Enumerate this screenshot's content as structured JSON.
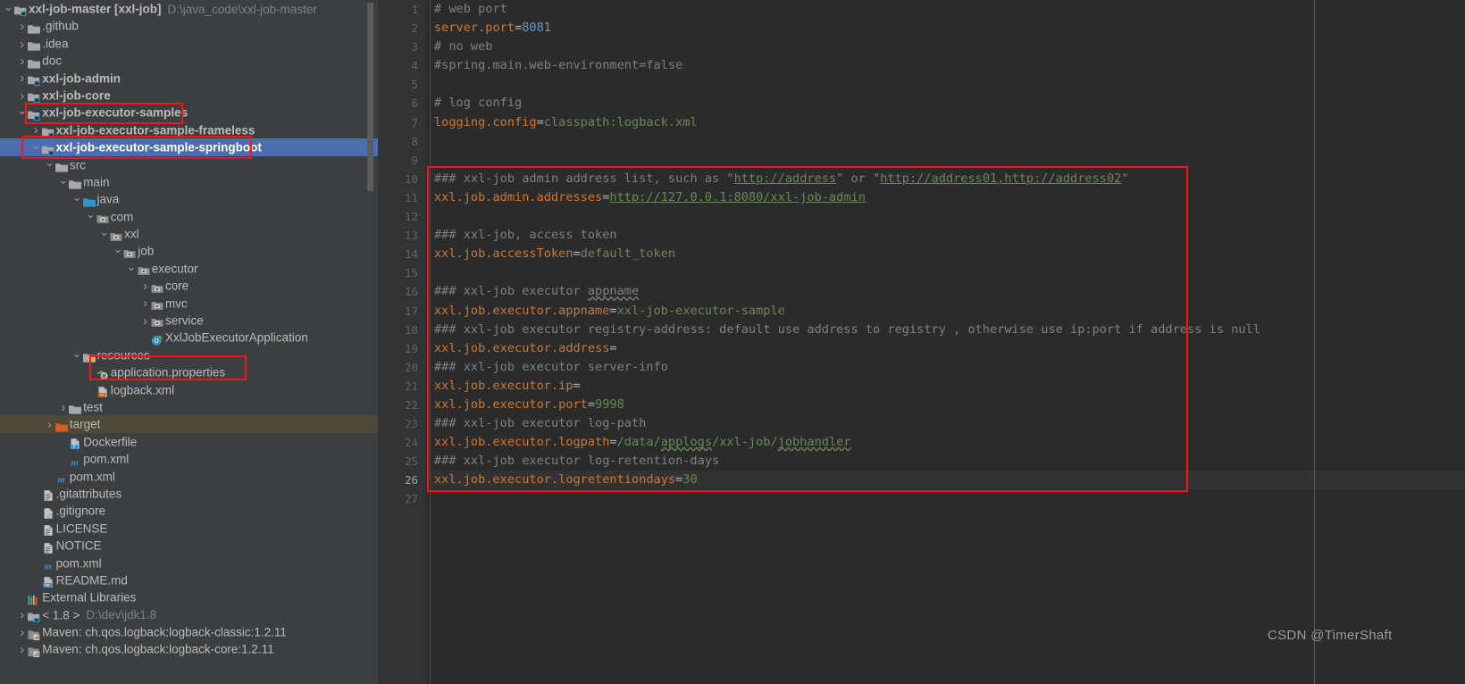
{
  "window": {
    "watermark": "CSDN @TimerShaft"
  },
  "tree": {
    "root": {
      "name": "xxl-job-master",
      "module": "[xxl-job]",
      "path": "D:\\java_code\\xxl-job-master"
    },
    "items": [
      {
        "indent": 0,
        "arrow": "v",
        "icon": "module-icon",
        "label": "xxl-job-master [xxl-job]",
        "suffix": "D:\\java_code\\xxl-job-master",
        "style": "root"
      },
      {
        "indent": 1,
        "arrow": ">",
        "icon": "folder-icon",
        "label": ".github"
      },
      {
        "indent": 1,
        "arrow": ">",
        "icon": "folder-icon",
        "label": ".idea"
      },
      {
        "indent": 1,
        "arrow": ">",
        "icon": "folder-icon",
        "label": "doc"
      },
      {
        "indent": 1,
        "arrow": ">",
        "icon": "module-icon",
        "label": "xxl-job-admin",
        "bold": true
      },
      {
        "indent": 1,
        "arrow": ">",
        "icon": "module-icon",
        "label": "xxl-job-core",
        "bold": true
      },
      {
        "indent": 1,
        "arrow": "v",
        "icon": "module-icon",
        "label": "xxl-job-executor-samples",
        "bold": true,
        "boxed": true
      },
      {
        "indent": 2,
        "arrow": ">",
        "icon": "module-icon",
        "label": "xxl-job-executor-sample-frameless",
        "bold": true
      },
      {
        "indent": 2,
        "arrow": "v",
        "icon": "module-icon",
        "label": "xxl-job-executor-sample-springboot",
        "bold": true,
        "selected": true,
        "boxed": true
      },
      {
        "indent": 3,
        "arrow": "v",
        "icon": "folder-icon",
        "label": "src"
      },
      {
        "indent": 4,
        "arrow": "v",
        "icon": "folder-icon",
        "label": "main"
      },
      {
        "indent": 5,
        "arrow": "v",
        "icon": "source-folder-icon",
        "label": "java"
      },
      {
        "indent": 6,
        "arrow": "v",
        "icon": "package-icon",
        "label": "com"
      },
      {
        "indent": 7,
        "arrow": "v",
        "icon": "package-icon",
        "label": "xxl"
      },
      {
        "indent": 8,
        "arrow": "v",
        "icon": "package-icon",
        "label": "job"
      },
      {
        "indent": 9,
        "arrow": "v",
        "icon": "package-icon",
        "label": "executor"
      },
      {
        "indent": 10,
        "arrow": ">",
        "icon": "package-icon",
        "label": "core"
      },
      {
        "indent": 10,
        "arrow": ">",
        "icon": "package-icon",
        "label": "mvc"
      },
      {
        "indent": 10,
        "arrow": ">",
        "icon": "package-icon",
        "label": "service"
      },
      {
        "indent": 10,
        "arrow": "none",
        "icon": "spring-class-icon",
        "label": "XxlJobExecutorApplication"
      },
      {
        "indent": 5,
        "arrow": "v",
        "icon": "resources-folder-icon",
        "label": "resources"
      },
      {
        "indent": 6,
        "arrow": "none",
        "icon": "properties-file-icon",
        "label": "application.properties",
        "boxed": true
      },
      {
        "indent": 6,
        "arrow": "none",
        "icon": "xml-file-icon",
        "label": "logback.xml"
      },
      {
        "indent": 4,
        "arrow": ">",
        "icon": "folder-icon",
        "label": "test"
      },
      {
        "indent": 3,
        "arrow": ">",
        "icon": "target-folder-icon",
        "label": "target",
        "hovered": true
      },
      {
        "indent": 4,
        "arrow": "none",
        "icon": "docker-file-icon",
        "label": "Dockerfile"
      },
      {
        "indent": 4,
        "arrow": "none",
        "icon": "maven-icon",
        "label": "pom.xml"
      },
      {
        "indent": 3,
        "arrow": "none",
        "icon": "maven-icon",
        "label": "pom.xml"
      },
      {
        "indent": 2,
        "arrow": "none",
        "icon": "text-file-icon",
        "label": ".gitattributes"
      },
      {
        "indent": 2,
        "arrow": "none",
        "icon": "gitignore-file-icon",
        "label": ".gitignore"
      },
      {
        "indent": 2,
        "arrow": "none",
        "icon": "text-file-icon",
        "label": "LICENSE"
      },
      {
        "indent": 2,
        "arrow": "none",
        "icon": "text-file-icon",
        "label": "NOTICE"
      },
      {
        "indent": 2,
        "arrow": "none",
        "icon": "maven-icon",
        "label": "pom.xml"
      },
      {
        "indent": 2,
        "arrow": "none",
        "icon": "markdown-file-icon",
        "label": "README.md"
      },
      {
        "indent": 1,
        "arrow": "none",
        "icon": "external-libraries-icon",
        "label": "External Libraries"
      },
      {
        "indent": 1,
        "arrow": ">",
        "icon": "jdk-icon",
        "label": "< 1.8 >",
        "suffix": "D:\\dev\\jdk1.8"
      },
      {
        "indent": 1,
        "arrow": ">",
        "icon": "library-icon",
        "label": "Maven: ch.qos.logback:logback-classic:1.2.11"
      },
      {
        "indent": 1,
        "arrow": ">",
        "icon": "library-icon",
        "label": "Maven: ch.qos.logback:logback-core:1.2.11"
      }
    ]
  },
  "editor": {
    "filename": "application.properties",
    "current_line": 26,
    "total_lines": 27,
    "line_numbers": [
      1,
      2,
      3,
      4,
      5,
      6,
      7,
      8,
      9,
      10,
      11,
      12,
      13,
      14,
      15,
      16,
      17,
      18,
      19,
      20,
      21,
      22,
      23,
      24,
      25,
      26,
      27
    ],
    "lines": [
      {
        "n": 1,
        "text": "# web port"
      },
      {
        "n": 2,
        "text": "server.port=8081"
      },
      {
        "n": 3,
        "text": "# no web"
      },
      {
        "n": 4,
        "text": "#spring.main.web-environment=false"
      },
      {
        "n": 5,
        "text": ""
      },
      {
        "n": 6,
        "text": "# log config"
      },
      {
        "n": 7,
        "text": "logging.config=classpath:logback.xml"
      },
      {
        "n": 8,
        "text": ""
      },
      {
        "n": 9,
        "text": ""
      },
      {
        "n": 10,
        "text": "### xxl-job admin address list, such as \"http://address\" or \"http://address01,http://address02\""
      },
      {
        "n": 11,
        "text": "xxl.job.admin.addresses=http://127.0.0.1:8080/xxl-job-admin"
      },
      {
        "n": 12,
        "text": ""
      },
      {
        "n": 13,
        "text": "### xxl-job, access token"
      },
      {
        "n": 14,
        "text": "xxl.job.accessToken=default_token"
      },
      {
        "n": 15,
        "text": ""
      },
      {
        "n": 16,
        "text": "### xxl-job executor appname"
      },
      {
        "n": 17,
        "text": "xxl.job.executor.appname=xxl-job-executor-sample"
      },
      {
        "n": 18,
        "text": "### xxl-job executor registry-address: default use address to registry , otherwise use ip:port if address is null"
      },
      {
        "n": 19,
        "text": "xxl.job.executor.address="
      },
      {
        "n": 20,
        "text": "### xxl-job executor server-info"
      },
      {
        "n": 21,
        "text": "xxl.job.executor.ip="
      },
      {
        "n": 22,
        "text": "xxl.job.executor.port=9998"
      },
      {
        "n": 23,
        "text": "### xxl-job executor log-path"
      },
      {
        "n": 24,
        "text": "xxl.job.executor.logpath=/data/applogs/xxl-job/jobhandler"
      },
      {
        "n": 25,
        "text": "### xxl-job executor log-retention-days"
      },
      {
        "n": 26,
        "text": "xxl.job.executor.logretentiondays=30"
      },
      {
        "n": 27,
        "text": ""
      }
    ]
  },
  "colors": {
    "background": "#2b2b2b",
    "panel": "#3c3f41",
    "gutter": "#313335",
    "selection": "#4b6eaf",
    "annotation": "#f01818",
    "comment": "#808080",
    "key": "#cc7832",
    "value": "#6a8759",
    "number": "#6897bb",
    "text": "#a9b7c6"
  }
}
